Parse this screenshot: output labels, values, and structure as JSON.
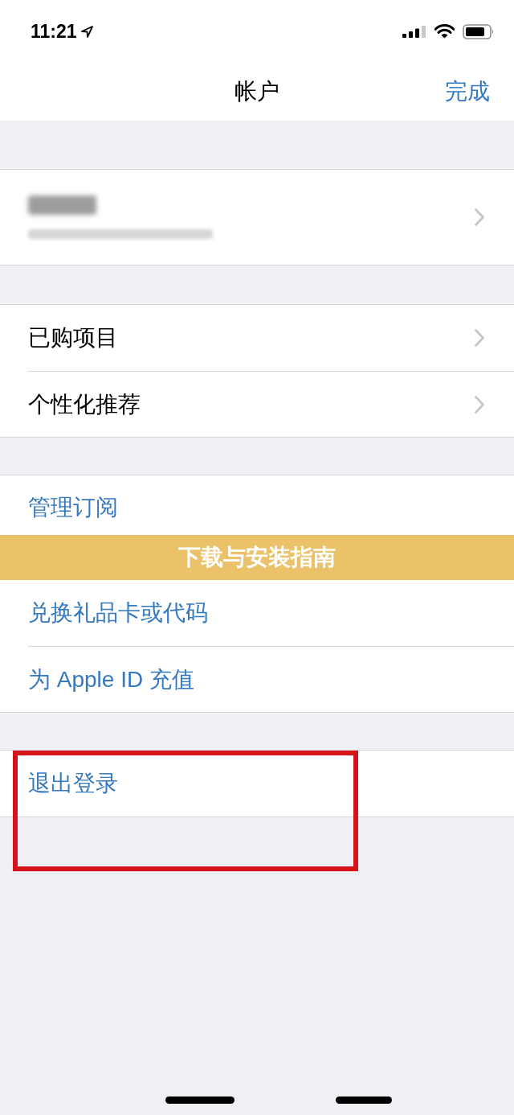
{
  "status_bar": {
    "time": "11:21"
  },
  "nav_bar": {
    "title": "帐户",
    "done_button": "完成"
  },
  "sections": [
    {
      "rows": [
        {
          "kind": "profile"
        }
      ]
    },
    {
      "rows": [
        {
          "kind": "link",
          "label": "已购项目"
        },
        {
          "kind": "link",
          "label": "个性化推荐"
        }
      ]
    },
    {
      "rows": [
        {
          "kind": "action",
          "label": "管理订阅"
        },
        {
          "kind": "banner",
          "label": "下载与安装指南"
        },
        {
          "kind": "action",
          "label": "兑换礼品卡或代码"
        },
        {
          "kind": "action",
          "label": "为 Apple ID 充值"
        }
      ]
    },
    {
      "rows": [
        {
          "kind": "action",
          "label": "退出登录"
        }
      ]
    }
  ]
}
